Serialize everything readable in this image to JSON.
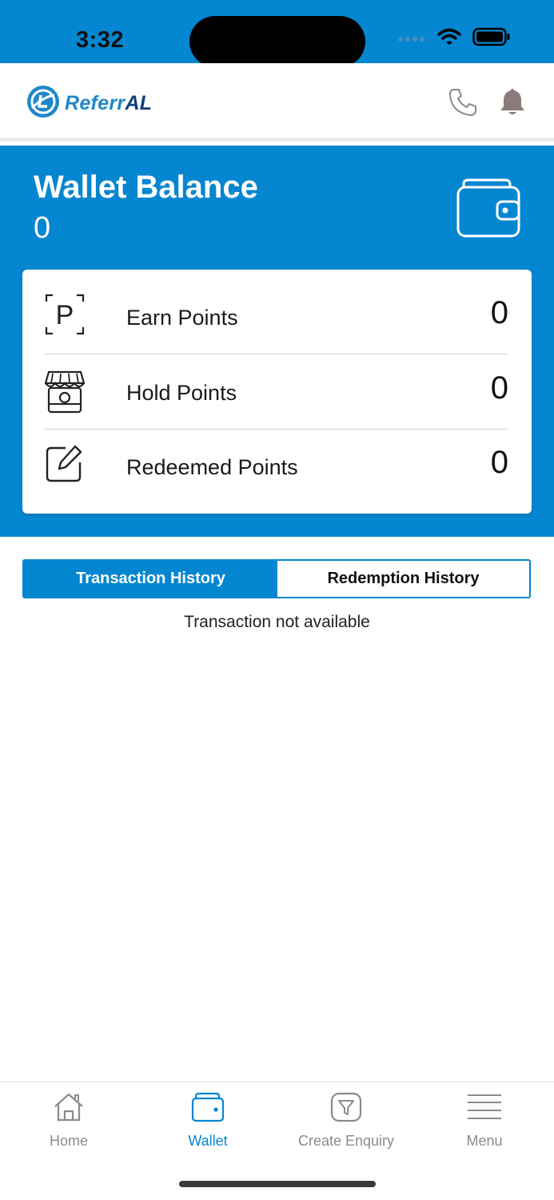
{
  "status_bar": {
    "time": "3:32",
    "icons": [
      "signal-icon",
      "wifi-icon",
      "battery-icon"
    ]
  },
  "header": {
    "logo_text_main": "Referr",
    "logo_text_accent": "AL",
    "icons": [
      "phone-icon",
      "bell-icon"
    ],
    "colors": {
      "brand_light": "#1f88c9",
      "brand_dark": "#123f7c"
    }
  },
  "wallet": {
    "title": "Wallet Balance",
    "balance": "0",
    "icon": "wallet-icon"
  },
  "points": [
    {
      "label": "Earn Points",
      "value": "0",
      "icon": "parking-p-icon"
    },
    {
      "label": "Hold Points",
      "value": "0",
      "icon": "store-icon"
    },
    {
      "label": "Redeemed Points",
      "value": "0",
      "icon": "edit-icon"
    }
  ],
  "tabs": [
    {
      "label": "Transaction History",
      "active": true
    },
    {
      "label": "Redemption History",
      "active": false
    }
  ],
  "empty_message": "Transaction not available",
  "bottom_nav": [
    {
      "label": "Home",
      "icon": "home-icon",
      "active": false
    },
    {
      "label": "Wallet",
      "icon": "wallet-icon",
      "active": true
    },
    {
      "label": "Create Enquiry",
      "icon": "funnel-icon",
      "active": false
    },
    {
      "label": "Menu",
      "icon": "menu-icon",
      "active": false
    }
  ],
  "colors": {
    "primary": "#0586d1",
    "inactive_nav": "#8b8b8b"
  }
}
